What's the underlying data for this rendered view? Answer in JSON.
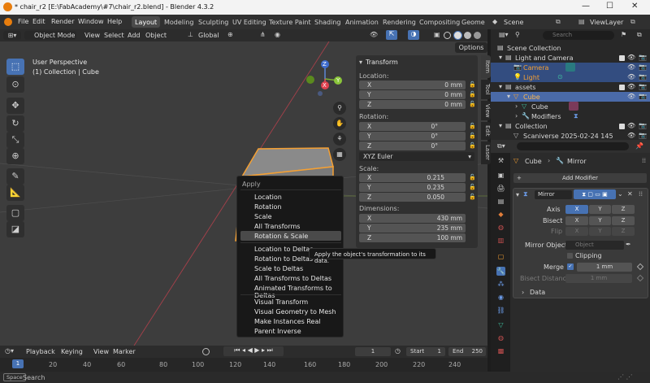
{
  "window": {
    "title": "* chair_r2 [E:\\FabAcademy\\#7\\chair_r2.blend] - Blender 4.3.2"
  },
  "menubar": {
    "file": "File",
    "edit": "Edit",
    "render": "Render",
    "window": "Window",
    "help": "Help"
  },
  "workspaces": [
    "Layout",
    "Modeling",
    "Sculpting",
    "UV Editing",
    "Texture Paint",
    "Shading",
    "Animation",
    "Rendering",
    "Compositing",
    "Geome"
  ],
  "scene": {
    "label": "Scene",
    "viewlayer": "ViewLayer"
  },
  "vphead": {
    "mode": "Object Mode",
    "view": "View",
    "select": "Select",
    "add": "Add",
    "object": "Object",
    "orientation": "Global"
  },
  "viewport": {
    "options": "Options",
    "perspective": "User Perspective",
    "collection": "(1) Collection | Cube"
  },
  "gizmo": {
    "x": "X",
    "y": "Y",
    "z": "Z"
  },
  "npanel": {
    "title": "Transform",
    "location_label": "Location:",
    "location": [
      {
        "axis": "X",
        "value": "0 mm"
      },
      {
        "axis": "Y",
        "value": "0 mm"
      },
      {
        "axis": "Z",
        "value": "0 mm"
      }
    ],
    "rotation_label": "Rotation:",
    "rotation": [
      {
        "axis": "X",
        "value": "0°"
      },
      {
        "axis": "Y",
        "value": "0°"
      },
      {
        "axis": "Z",
        "value": "0°"
      }
    ],
    "euler": "XYZ Euler",
    "scale_label": "Scale:",
    "scale": [
      {
        "axis": "X",
        "value": "0.215"
      },
      {
        "axis": "Y",
        "value": "0.235"
      },
      {
        "axis": "Z",
        "value": "0.050"
      }
    ],
    "dimensions_label": "Dimensions:",
    "dimensions": [
      {
        "axis": "X",
        "value": "430 mm"
      },
      {
        "axis": "Y",
        "value": "235 mm"
      },
      {
        "axis": "Z",
        "value": "100 mm"
      }
    ]
  },
  "ntabs": [
    "Item",
    "Tool",
    "View",
    "Edit",
    "Laser"
  ],
  "contextmenu": {
    "title": "Apply",
    "items": [
      "Location",
      "Rotation",
      "Scale",
      "All Transforms",
      "Rotation & Scale",
      "Location to Deltas",
      "Rotation to Deltas",
      "Scale to Deltas",
      "All Transforms to Deltas",
      "Animated Transforms to Deltas",
      "Visual Transform",
      "Visual Geometry to Mesh",
      "Make Instances Real",
      "Parent Inverse"
    ]
  },
  "tooltip": "Apply the object's transformation to its data.",
  "timeline": {
    "playback": "Playback",
    "keying": "Keying",
    "view": "View",
    "marker": "Marker",
    "current": "1",
    "start_label": "Start",
    "start": "1",
    "end_label": "End",
    "end": "250",
    "ticks": [
      "1",
      "20",
      "40",
      "60",
      "80",
      "100",
      "120",
      "140",
      "160",
      "180",
      "200",
      "220",
      "240"
    ]
  },
  "statusbar": {
    "key": "Space",
    "action": "Search"
  },
  "outliner": {
    "search_placeholder": "Search",
    "rows": [
      "Scene Collection",
      "Light and Camera",
      "Camera",
      "Light",
      "assets",
      "Cube",
      "Cube",
      "Modifiers",
      "Collection",
      "Scaniverse 2025-02-24 145"
    ]
  },
  "properties": {
    "search_placeholder": "",
    "breadcrumb_object": "Cube",
    "breadcrumb_modifier": "Mirror",
    "add_modifier": "Add Modifier",
    "modifier_name": "Mirror",
    "axis_label": "Axis",
    "bisect_label": "Bisect",
    "flip_label": "Flip",
    "x": "X",
    "y": "Y",
    "z": "Z",
    "mirror_object_label": "Mirror Object",
    "mirror_object_placeholder": "Object",
    "clipping": "Clipping",
    "merge_label": "Merge",
    "merge_value": "1 mm",
    "bisect_distance_label": "Bisect Distance",
    "bisect_distance_value": "1 mm",
    "data_section": "Data"
  },
  "colors": {
    "accent": "#4772b3",
    "selected_orange": "#f5a033",
    "active_row": "#334d80"
  }
}
